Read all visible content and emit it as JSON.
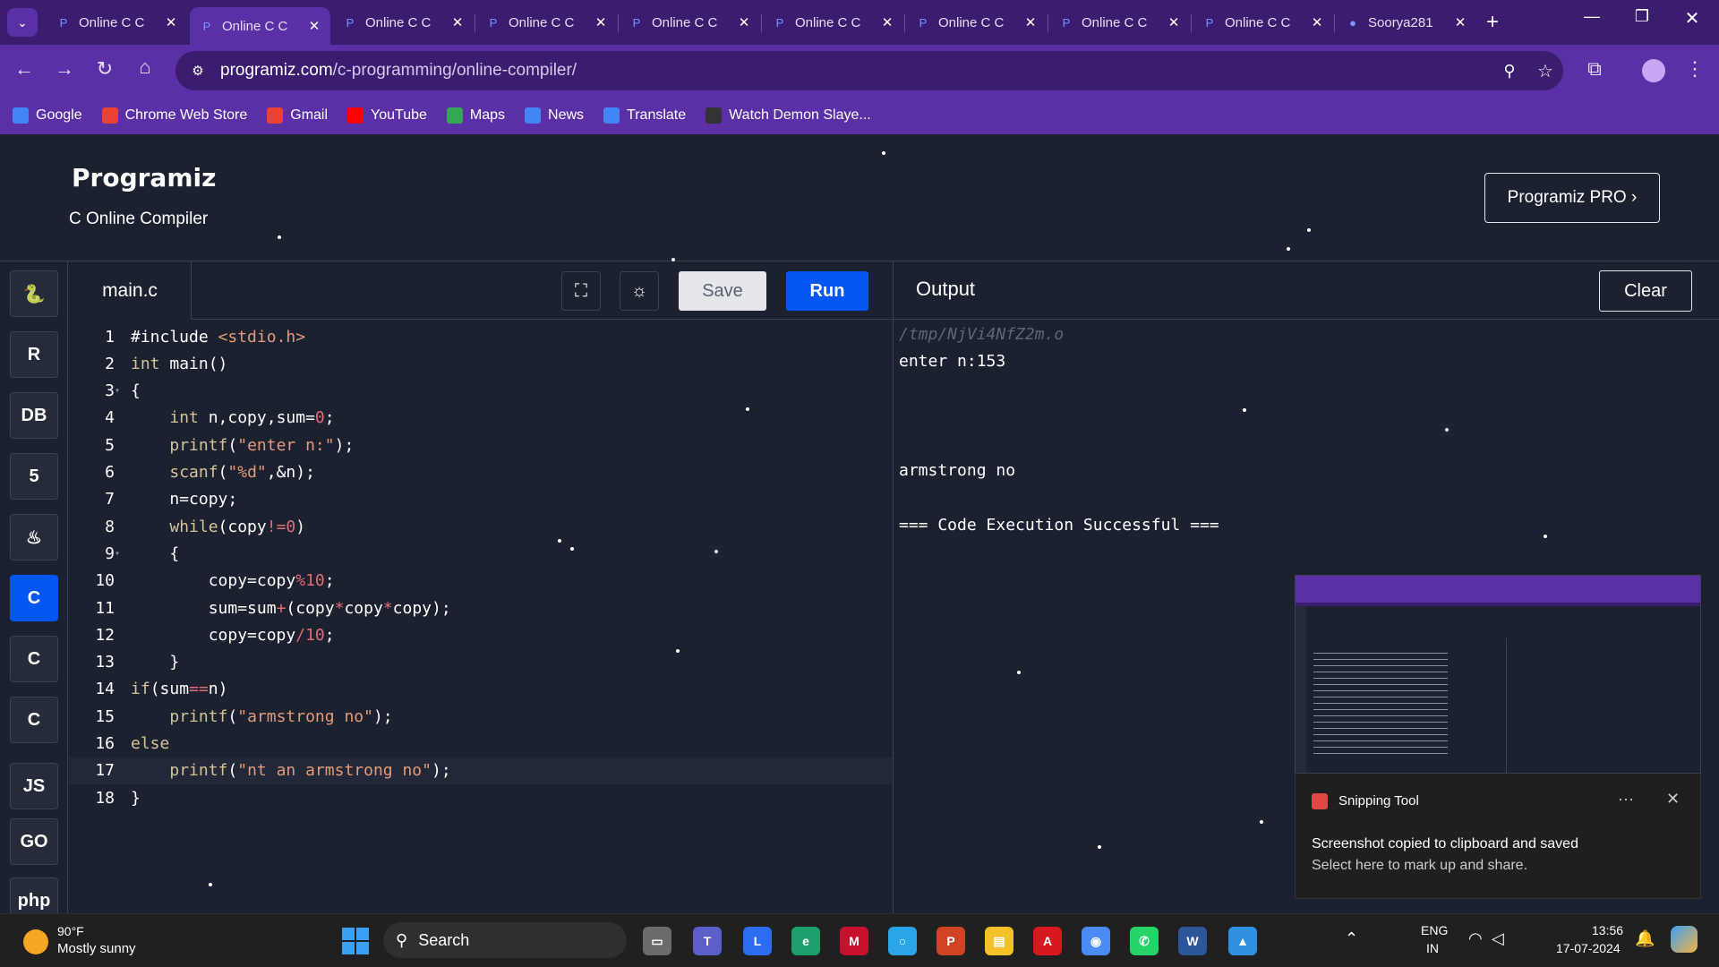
{
  "browser": {
    "tabs": [
      {
        "label": "Online C C",
        "active": false
      },
      {
        "label": "Online C C",
        "active": true
      },
      {
        "label": "Online C C",
        "active": false
      },
      {
        "label": "Online C C",
        "active": false
      },
      {
        "label": "Online C C",
        "active": false
      },
      {
        "label": "Online C C",
        "active": false
      },
      {
        "label": "Online C C",
        "active": false
      },
      {
        "label": "Online C C",
        "active": false
      },
      {
        "label": "Online C C",
        "active": false
      },
      {
        "label": "Soorya281",
        "active": false
      }
    ],
    "url_domain": "programiz.com",
    "url_path": "/c-programming/online-compiler/",
    "bookmarks": [
      {
        "label": "Google",
        "icon": "google-icon",
        "color": "#4285f4"
      },
      {
        "label": "Chrome Web Store",
        "icon": "chrome-web-store-icon",
        "color": "#ea4335"
      },
      {
        "label": "Gmail",
        "icon": "gmail-icon",
        "color": "#ea4335"
      },
      {
        "label": "YouTube",
        "icon": "youtube-icon",
        "color": "#ff0000"
      },
      {
        "label": "Maps",
        "icon": "maps-icon",
        "color": "#34a853"
      },
      {
        "label": "News",
        "icon": "news-icon",
        "color": "#4285f4"
      },
      {
        "label": "Translate",
        "icon": "translate-icon",
        "color": "#4285f4"
      },
      {
        "label": "Watch Demon Slaye...",
        "icon": "hianime-icon",
        "color": "#333333"
      }
    ]
  },
  "header": {
    "logo": "Programiz",
    "subtitle": "C Online Compiler",
    "pro_button": "Programiz PRO ›"
  },
  "sidebar": {
    "items": [
      {
        "name": "python",
        "glyph": "🐍",
        "active": false
      },
      {
        "name": "r",
        "glyph": "R",
        "active": false
      },
      {
        "name": "sql",
        "glyph": "DB",
        "active": false
      },
      {
        "name": "html",
        "glyph": "5",
        "active": false
      },
      {
        "name": "java",
        "glyph": "♨",
        "active": false
      },
      {
        "name": "c",
        "glyph": "C",
        "active": true
      },
      {
        "name": "cpp",
        "glyph": "C",
        "active": false
      },
      {
        "name": "csharp",
        "glyph": "C",
        "active": false
      },
      {
        "name": "js",
        "glyph": "JS",
        "active": false
      },
      {
        "name": "go",
        "glyph": "GO",
        "active": false
      },
      {
        "name": "php",
        "glyph": "php",
        "active": false
      }
    ]
  },
  "editor": {
    "filename": "main.c",
    "save_label": "Save",
    "run_label": "Run",
    "lines": [
      {
        "n": "1",
        "text": "#include <stdio.h>"
      },
      {
        "n": "2",
        "text": "int main()"
      },
      {
        "n": "3",
        "text": "{"
      },
      {
        "n": "4",
        "text": "    int n,copy,sum=0;"
      },
      {
        "n": "5",
        "text": "    printf(\"enter n:\");"
      },
      {
        "n": "6",
        "text": "    scanf(\"%d\",&n);"
      },
      {
        "n": "7",
        "text": "    n=copy;"
      },
      {
        "n": "8",
        "text": "    while(copy!=0)"
      },
      {
        "n": "9",
        "text": "    {"
      },
      {
        "n": "10",
        "text": "        copy=copy%10;"
      },
      {
        "n": "11",
        "text": "        sum=sum+(copy*copy*copy);"
      },
      {
        "n": "12",
        "text": "        copy=copy/10;"
      },
      {
        "n": "13",
        "text": "    }"
      },
      {
        "n": "14",
        "text": "if(sum==n)"
      },
      {
        "n": "15",
        "text": "    printf(\"armstrong no\");"
      },
      {
        "n": "16",
        "text": "else"
      },
      {
        "n": "17",
        "text": "    printf(\"nt an armstrong no\");"
      },
      {
        "n": "18",
        "text": "}"
      }
    ]
  },
  "output": {
    "title": "Output",
    "clear_label": "Clear",
    "lines": [
      {
        "text": "/tmp/NjVi4NfZ2m.o",
        "dim": true
      },
      {
        "text": "enter n:153",
        "dim": false
      },
      {
        "text": "armstrong no",
        "dim": false
      },
      {
        "text": "=== Code Execution Successful ===",
        "dim": false
      }
    ]
  },
  "toast": {
    "app": "Snipping Tool",
    "title": "Screenshot copied to clipboard and saved",
    "body": "Select here to mark up and share."
  },
  "taskbar": {
    "weather_temp": "90°F",
    "weather_desc": "Mostly sunny",
    "search_label": "Search",
    "lang_top": "ENG",
    "lang_bottom": "IN",
    "time": "13:56",
    "date": "17-07-2024"
  }
}
